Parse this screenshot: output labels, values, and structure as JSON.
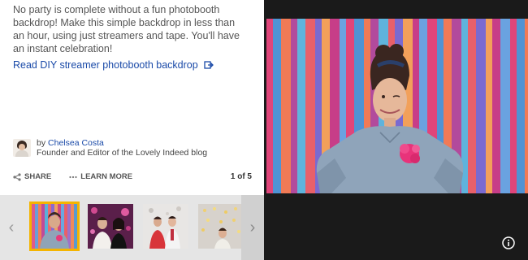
{
  "article": {
    "description": "No party is complete without a fun photobooth backdrop! Make this simple backdrop in less than an hour, using just streamers and tape. You'll have an instant celebration!",
    "read_link": "Read DIY streamer photobooth backdrop",
    "link_icon": "external-link-icon"
  },
  "author": {
    "by": "by",
    "name": "Chelsea Costa",
    "role": "Founder and Editor of the Lovely Indeed blog"
  },
  "actions": {
    "share": "SHARE",
    "learn_more": "LEARN MORE",
    "counter": "1 of 5"
  },
  "gallery": {
    "prev_arrow": "‹",
    "next_arrow": "›",
    "thumbnails": [
      "thumbnail-1",
      "thumbnail-2",
      "thumbnail-3",
      "thumbnail-4"
    ],
    "active_index": 0
  },
  "colors": {
    "accent_border": "#f4b400",
    "link": "#1a4aa8",
    "background": "#1a1a1a"
  }
}
